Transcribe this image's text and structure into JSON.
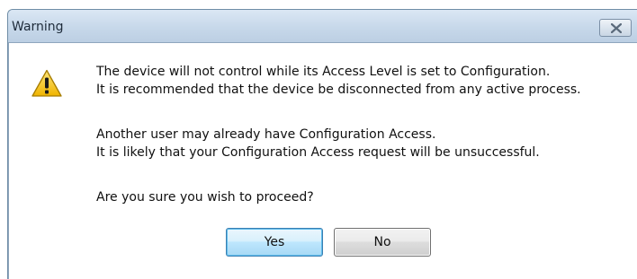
{
  "dialog": {
    "title": "Warning",
    "icon": "warning-triangle-icon",
    "message_lines": [
      "The device will not control while its Access Level is set to Configuration.",
      "It is recommended that the device be disconnected from any active process.",
      "Another user may already have Configuration Access.",
      "It is likely that your Configuration Access request will be unsuccessful.",
      "Are you sure you wish to proceed?"
    ],
    "buttons": {
      "yes_label": "Yes",
      "no_label": "No"
    },
    "close_icon": "close-icon"
  },
  "colors": {
    "titlebar": "#c7d8ea",
    "warning_yellow": "#f8c91c",
    "default_button": "#bee6fd"
  }
}
